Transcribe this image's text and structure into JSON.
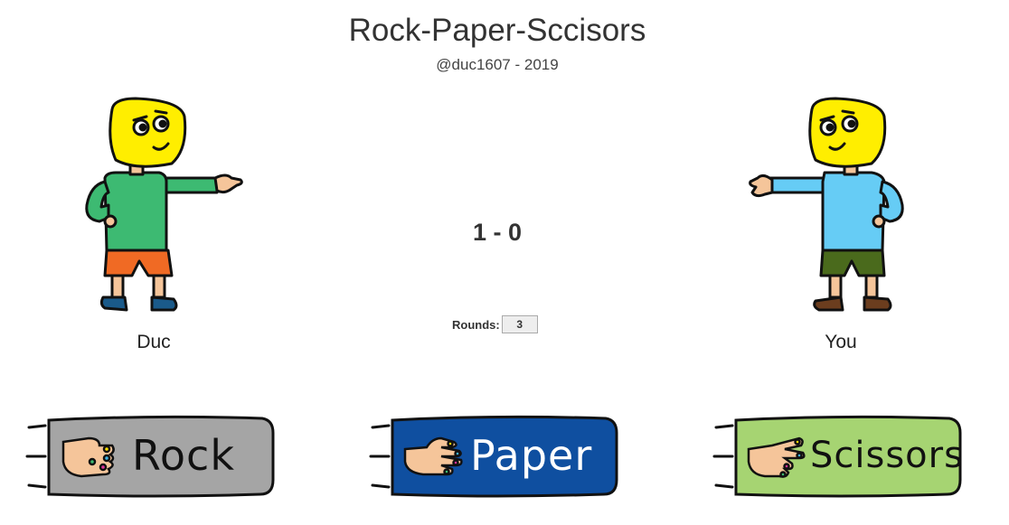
{
  "header": {
    "title": "Rock-Paper-Sccisors",
    "subtitle": "@duc1607 - 2019"
  },
  "players": {
    "left": {
      "name": "Duc",
      "shirt_color": "#3dba72",
      "shorts_color": "#f06a24",
      "shoe_color": "#1a5a8a"
    },
    "right": {
      "name": "You",
      "shirt_color": "#66ccf5",
      "shorts_color": "#4a6a1c",
      "shoe_color": "#6b3d1e"
    }
  },
  "score": {
    "text": "1 - 0"
  },
  "rounds": {
    "label": "Rounds:",
    "value": "3"
  },
  "choices": [
    {
      "label": "Rock",
      "color": "#a5a5a5",
      "text_color": "#111111",
      "icon": "fist-icon"
    },
    {
      "label": "Paper",
      "color": "#0f4fa0",
      "text_color": "#ffffff",
      "icon": "open-hand-icon"
    },
    {
      "label": "Scissors",
      "color": "#a6d472",
      "text_color": "#111111",
      "icon": "peace-hand-icon"
    }
  ],
  "colors": {
    "face": "#ffee00",
    "skin": "#f5c59a",
    "outline": "#111111"
  }
}
